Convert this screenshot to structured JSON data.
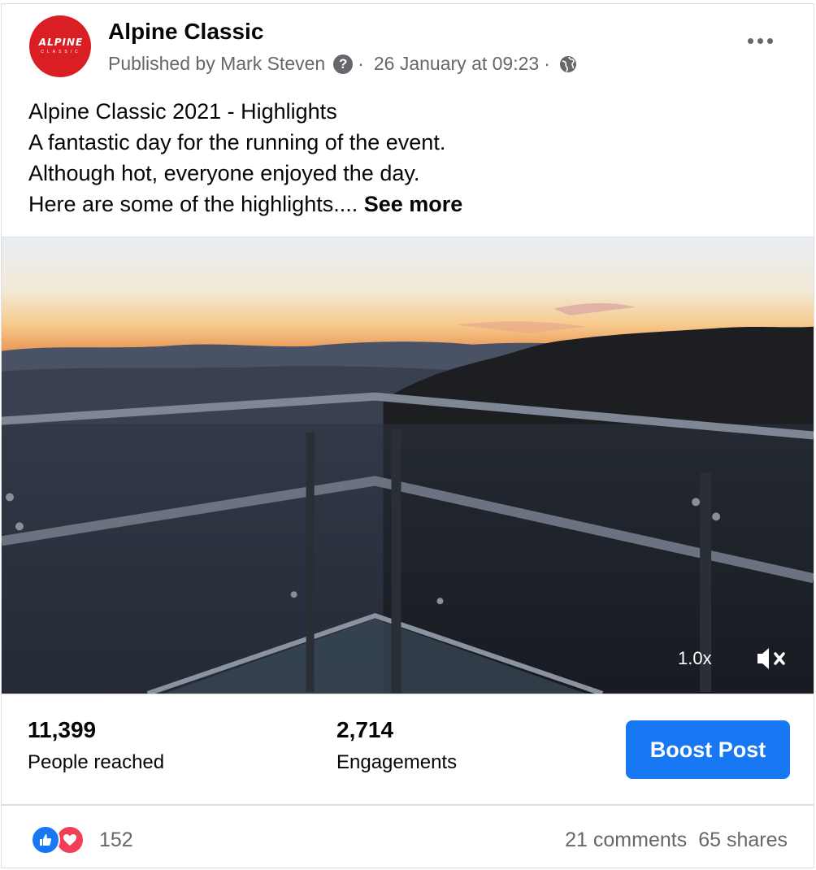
{
  "post": {
    "page_name": "Alpine Classic",
    "avatar_logo": "ALPINE",
    "avatar_logo_sub": "CLASSIC",
    "published_by": "Published by Mark Steven",
    "timestamp": "26 January at 09:23",
    "separator": "·",
    "help_icon": "question-circle-icon",
    "audience_icon": "globe-icon",
    "more_icon": "more-options-icon",
    "caption_lines": [
      "Alpine Classic 2021 - Highlights",
      "A fantastic day for the running of the event.",
      "Although hot, everyone enjoyed the day.",
      "Here are some of the highlights...."
    ],
    "see_more": "See more"
  },
  "video": {
    "speed": "1.0x",
    "mute_icon": "volume-muted-icon"
  },
  "stats": {
    "reached_value": "11,399",
    "reached_label": "People reached",
    "engagements_value": "2,714",
    "engagements_label": "Engagements",
    "boost_label": "Boost Post"
  },
  "footer": {
    "reaction_icons": [
      "like-icon",
      "love-icon"
    ],
    "reactions_count": "152",
    "comments": "21 comments",
    "shares": "65 shares"
  },
  "colors": {
    "accent": "#1877f2",
    "brand_red": "#d91e24",
    "love": "#f33e58",
    "secondary_text": "#65676b"
  }
}
